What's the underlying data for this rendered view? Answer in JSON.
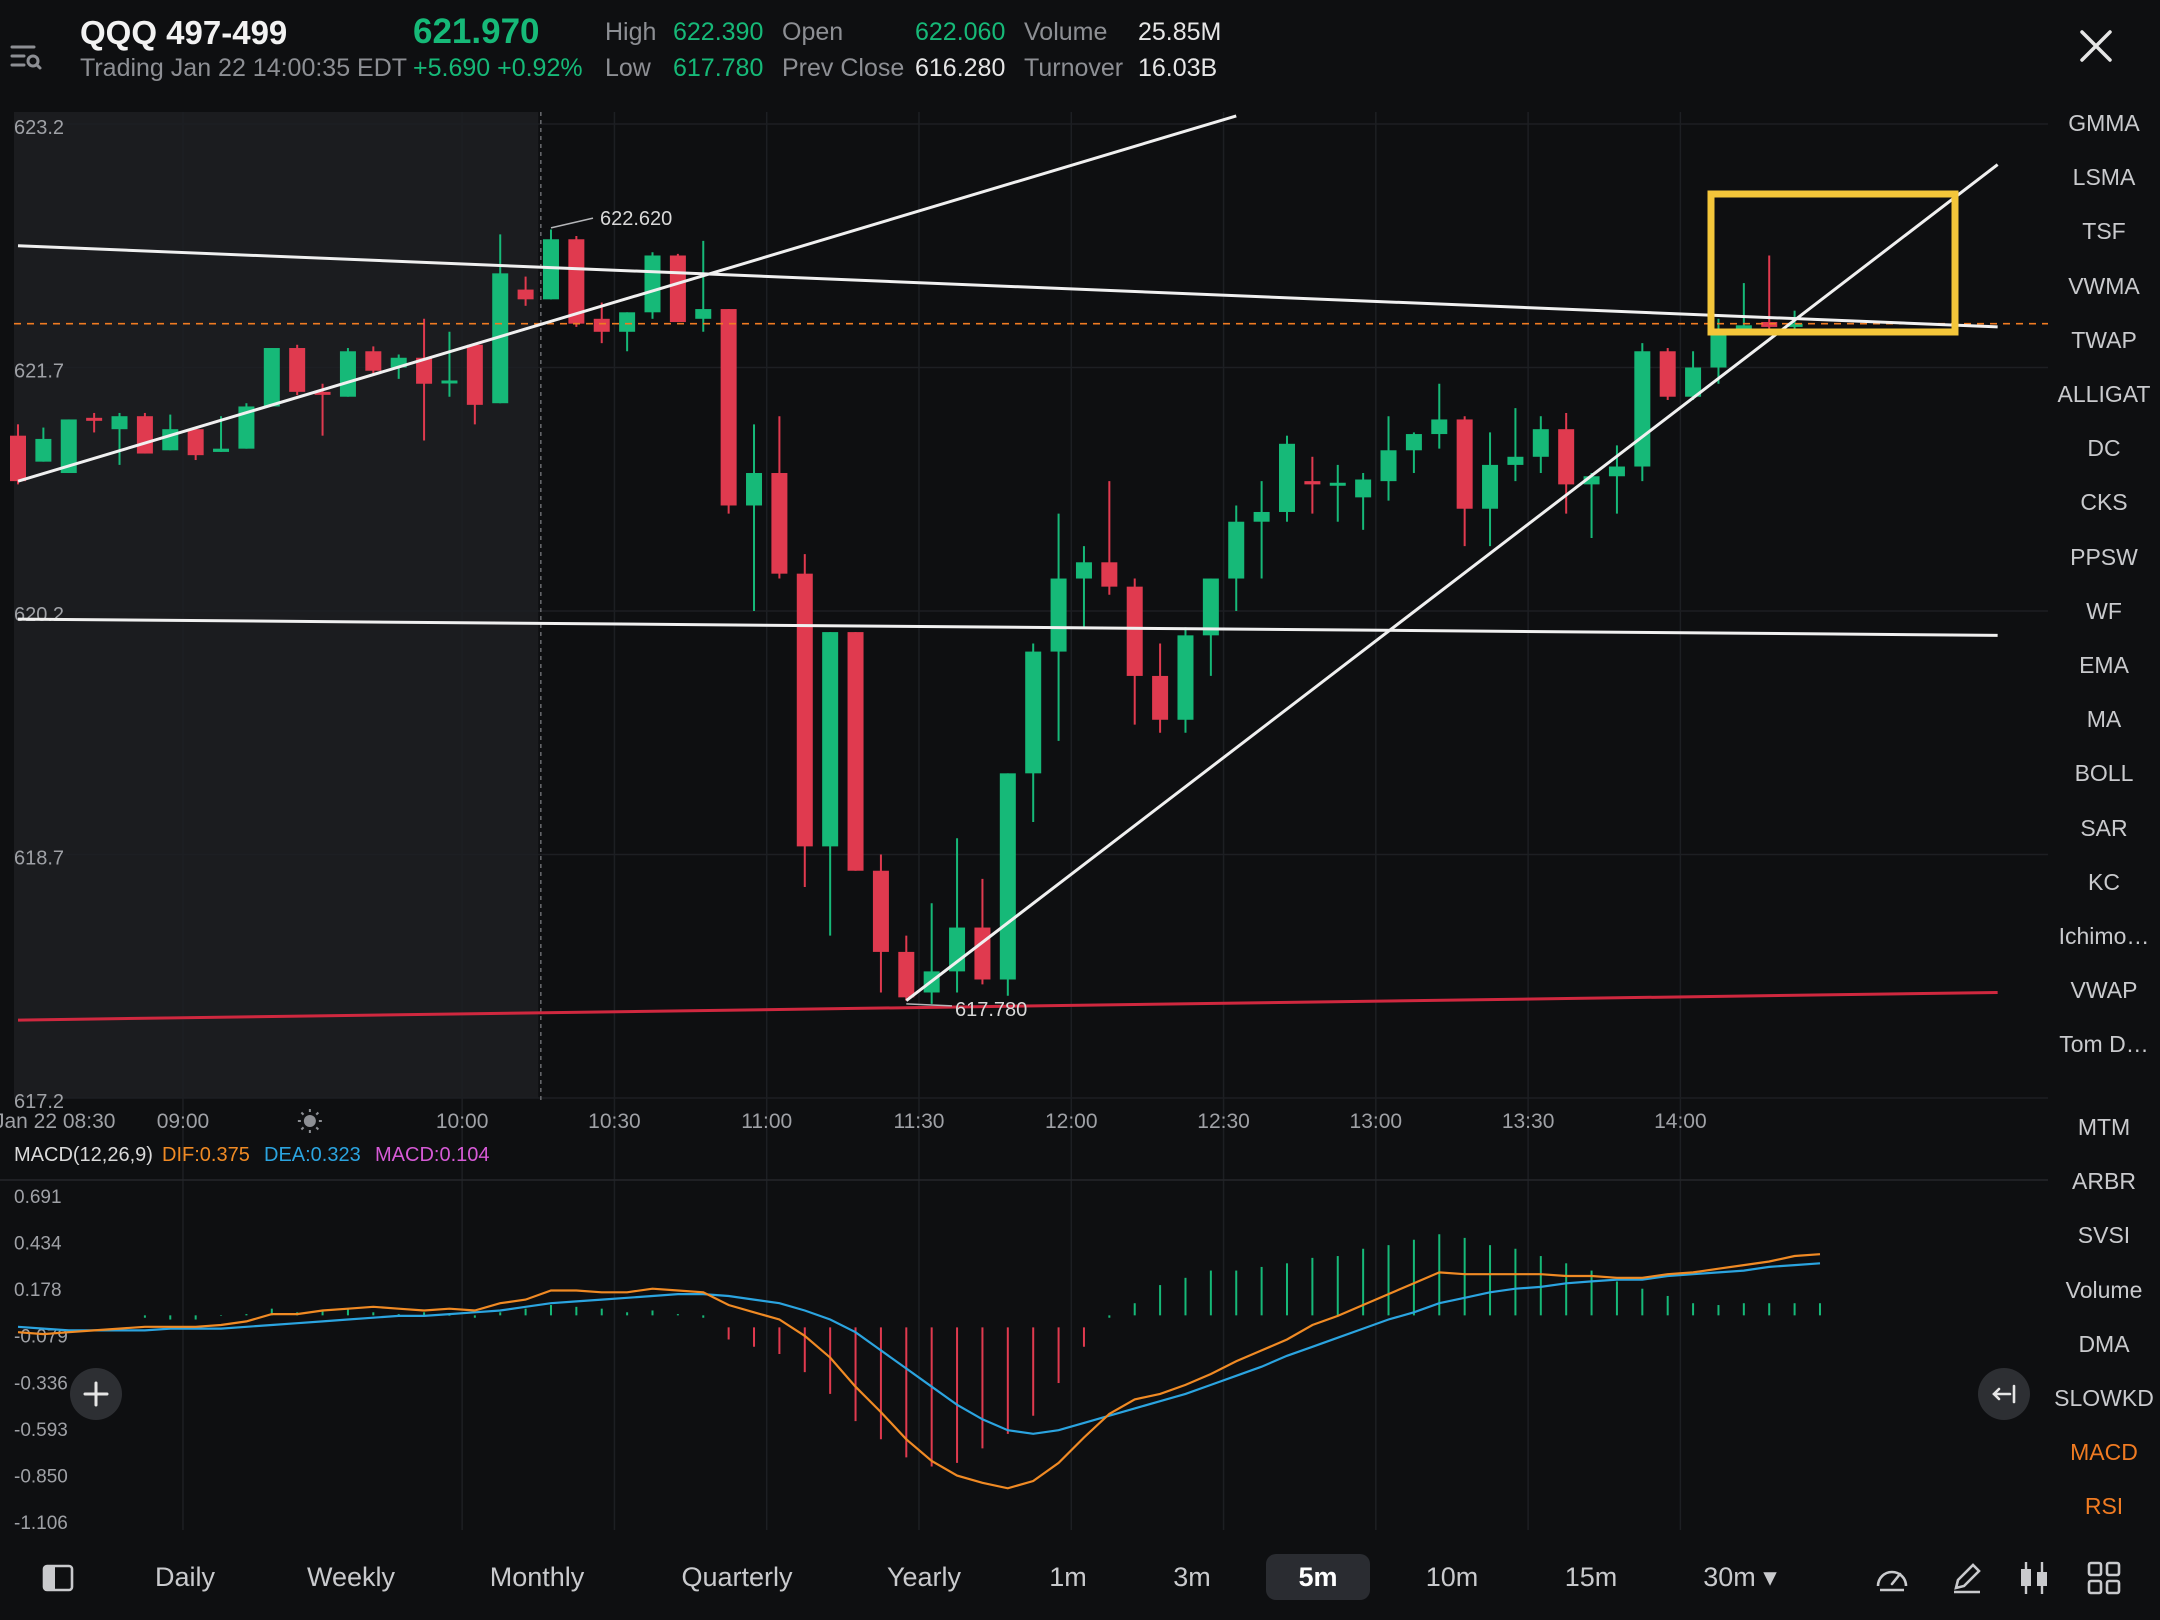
{
  "header": {
    "symbol": "QQQ  497-499",
    "status": "Trading Jan 22 14:00:35 EDT",
    "price": "621.970",
    "change": "+5.690 +0.92%",
    "high_label": "High",
    "high": "622.390",
    "low_label": "Low",
    "low": "617.780",
    "open_label": "Open",
    "open": "622.060",
    "prev_close_label": "Prev Close",
    "prev_close": "616.280",
    "volume_label": "Volume",
    "volume": "25.85M",
    "turnover_label": "Turnover",
    "turnover": "16.03B"
  },
  "colors": {
    "up": "#16b978",
    "down": "#e03a4f",
    "accent": "#f07b22",
    "highlight": "#f4c63a",
    "background": "#0e0f11"
  },
  "chart_data": {
    "type": "candlestick",
    "interval": "5m",
    "y_axis_labels": [
      "623.2",
      "621.7",
      "620.2",
      "618.7",
      "617.2"
    ],
    "ylim": [
      617.2,
      623.2
    ],
    "x_axis_labels": [
      "Jan 22 08:30",
      "09:00",
      "10:00",
      "10:30",
      "11:00",
      "11:30",
      "12:00",
      "12:30",
      "13:00",
      "13:30",
      "14:00"
    ],
    "annotations": {
      "high_marker": "622.620",
      "low_marker": "617.780"
    },
    "last_price_line": 621.97,
    "candles": [
      {
        "o": 621.28,
        "h": 621.35,
        "l": 620.98,
        "c": 621.0
      },
      {
        "o": 621.12,
        "h": 621.33,
        "l": 621.12,
        "c": 621.26
      },
      {
        "o": 621.05,
        "h": 621.38,
        "l": 621.05,
        "c": 621.38
      },
      {
        "o": 621.39,
        "h": 621.42,
        "l": 621.3,
        "c": 621.38
      },
      {
        "o": 621.32,
        "h": 621.42,
        "l": 621.1,
        "c": 621.4
      },
      {
        "o": 621.4,
        "h": 621.42,
        "l": 621.17,
        "c": 621.17
      },
      {
        "o": 621.19,
        "h": 621.41,
        "l": 621.19,
        "c": 621.32
      },
      {
        "o": 621.32,
        "h": 621.32,
        "l": 621.13,
        "c": 621.16
      },
      {
        "o": 621.18,
        "h": 621.4,
        "l": 621.18,
        "c": 621.2
      },
      {
        "o": 621.2,
        "h": 621.48,
        "l": 621.2,
        "c": 621.46
      },
      {
        "o": 621.46,
        "h": 621.82,
        "l": 621.46,
        "c": 621.82
      },
      {
        "o": 621.82,
        "h": 621.84,
        "l": 621.53,
        "c": 621.55
      },
      {
        "o": 621.55,
        "h": 621.6,
        "l": 621.28,
        "c": 621.54
      },
      {
        "o": 621.52,
        "h": 621.82,
        "l": 621.52,
        "c": 621.8
      },
      {
        "o": 621.8,
        "h": 621.83,
        "l": 621.65,
        "c": 621.68
      },
      {
        "o": 621.7,
        "h": 621.78,
        "l": 621.63,
        "c": 621.76
      },
      {
        "o": 621.76,
        "h": 622.0,
        "l": 621.25,
        "c": 621.6
      },
      {
        "o": 621.62,
        "h": 621.92,
        "l": 621.52,
        "c": 621.62
      },
      {
        "o": 621.84,
        "h": 621.84,
        "l": 621.35,
        "c": 621.47
      },
      {
        "o": 621.48,
        "h": 622.52,
        "l": 621.48,
        "c": 622.28
      },
      {
        "o": 622.18,
        "h": 622.26,
        "l": 622.08,
        "c": 622.12
      },
      {
        "o": 622.12,
        "h": 622.55,
        "l": 622.12,
        "c": 622.49
      },
      {
        "o": 622.49,
        "h": 622.51,
        "l": 621.95,
        "c": 621.97
      },
      {
        "o": 622.0,
        "h": 622.1,
        "l": 621.85,
        "c": 621.92
      },
      {
        "o": 621.92,
        "h": 622.04,
        "l": 621.8,
        "c": 622.04
      },
      {
        "o": 622.04,
        "h": 622.41,
        "l": 622.0,
        "c": 622.39
      },
      {
        "o": 622.39,
        "h": 622.4,
        "l": 621.98,
        "c": 621.98
      },
      {
        "o": 622.0,
        "h": 622.48,
        "l": 621.92,
        "c": 622.06
      },
      {
        "o": 622.06,
        "h": 622.06,
        "l": 620.8,
        "c": 620.85
      },
      {
        "o": 620.85,
        "h": 621.35,
        "l": 620.2,
        "c": 621.05
      },
      {
        "o": 621.05,
        "h": 621.4,
        "l": 620.4,
        "c": 620.43
      },
      {
        "o": 620.43,
        "h": 620.55,
        "l": 618.5,
        "c": 618.75
      },
      {
        "o": 618.75,
        "h": 620.07,
        "l": 618.2,
        "c": 620.07
      },
      {
        "o": 620.07,
        "h": 620.07,
        "l": 618.6,
        "c": 618.6
      },
      {
        "o": 618.6,
        "h": 618.7,
        "l": 617.85,
        "c": 618.1
      },
      {
        "o": 618.1,
        "h": 618.2,
        "l": 617.8,
        "c": 617.82
      },
      {
        "o": 617.85,
        "h": 618.4,
        "l": 617.78,
        "c": 617.98
      },
      {
        "o": 617.98,
        "h": 618.8,
        "l": 617.85,
        "c": 618.25
      },
      {
        "o": 618.25,
        "h": 618.55,
        "l": 617.9,
        "c": 617.93
      },
      {
        "o": 617.93,
        "h": 619.2,
        "l": 617.83,
        "c": 619.2
      },
      {
        "o": 619.2,
        "h": 620.0,
        "l": 618.9,
        "c": 619.95
      },
      {
        "o": 619.95,
        "h": 620.8,
        "l": 619.4,
        "c": 620.4
      },
      {
        "o": 620.4,
        "h": 620.6,
        "l": 620.1,
        "c": 620.5
      },
      {
        "o": 620.5,
        "h": 621.0,
        "l": 620.3,
        "c": 620.35
      },
      {
        "o": 620.35,
        "h": 620.4,
        "l": 619.5,
        "c": 619.8
      },
      {
        "o": 619.8,
        "h": 620.0,
        "l": 619.45,
        "c": 619.53
      },
      {
        "o": 619.53,
        "h": 620.1,
        "l": 619.45,
        "c": 620.05
      },
      {
        "o": 620.05,
        "h": 620.4,
        "l": 619.8,
        "c": 620.4
      },
      {
        "o": 620.4,
        "h": 620.85,
        "l": 620.2,
        "c": 620.75
      },
      {
        "o": 620.75,
        "h": 621.0,
        "l": 620.4,
        "c": 620.81
      },
      {
        "o": 620.81,
        "h": 621.28,
        "l": 620.75,
        "c": 621.23
      },
      {
        "o": 621.0,
        "h": 621.15,
        "l": 620.8,
        "c": 620.98
      },
      {
        "o": 620.98,
        "h": 621.1,
        "l": 620.75,
        "c": 620.99
      },
      {
        "o": 620.9,
        "h": 621.05,
        "l": 620.7,
        "c": 621.01
      },
      {
        "o": 621.0,
        "h": 621.4,
        "l": 620.88,
        "c": 621.19
      },
      {
        "o": 621.19,
        "h": 621.3,
        "l": 621.05,
        "c": 621.29
      },
      {
        "o": 621.29,
        "h": 621.6,
        "l": 621.2,
        "c": 621.38
      },
      {
        "o": 621.38,
        "h": 621.4,
        "l": 620.6,
        "c": 620.83
      },
      {
        "o": 620.83,
        "h": 621.3,
        "l": 620.6,
        "c": 621.1
      },
      {
        "o": 621.1,
        "h": 621.45,
        "l": 621.0,
        "c": 621.15
      },
      {
        "o": 621.15,
        "h": 621.4,
        "l": 621.05,
        "c": 621.32
      },
      {
        "o": 621.32,
        "h": 621.42,
        "l": 620.8,
        "c": 620.98
      },
      {
        "o": 620.98,
        "h": 621.05,
        "l": 620.65,
        "c": 621.03
      },
      {
        "o": 621.03,
        "h": 621.22,
        "l": 620.8,
        "c": 621.09
      },
      {
        "o": 621.09,
        "h": 621.85,
        "l": 621.0,
        "c": 621.8
      },
      {
        "o": 621.8,
        "h": 621.82,
        "l": 621.5,
        "c": 621.52
      },
      {
        "o": 621.52,
        "h": 621.8,
        "l": 621.5,
        "c": 621.7
      },
      {
        "o": 621.7,
        "h": 622.0,
        "l": 621.6,
        "c": 621.94
      },
      {
        "o": 621.94,
        "h": 622.22,
        "l": 621.9,
        "c": 621.96
      },
      {
        "o": 621.98,
        "h": 622.39,
        "l": 621.93,
        "c": 621.95
      },
      {
        "o": 621.95,
        "h": 622.05,
        "l": 621.9,
        "c": 621.97
      }
    ],
    "trend_lines": [
      {
        "color": "white",
        "from": {
          "candle": 0,
          "price": 622.45
        },
        "to": {
          "candle": 78,
          "price": 621.95
        }
      },
      {
        "color": "white",
        "from": {
          "candle": 0,
          "price": 621.0
        },
        "to": {
          "candle": 48,
          "price": 623.25
        }
      },
      {
        "color": "white",
        "from": {
          "candle": 0,
          "price": 620.15
        },
        "to": {
          "candle": 78,
          "price": 620.05
        }
      },
      {
        "color": "white",
        "from": {
          "candle": 35,
          "price": 617.8
        },
        "to": {
          "candle": 78,
          "price": 622.95
        }
      },
      {
        "color": "red",
        "from": {
          "candle": 0,
          "price": 617.68
        },
        "to": {
          "candle": 78,
          "price": 617.85
        }
      }
    ],
    "macd": {
      "title": "MACD(12,26,9)",
      "dif_label": "DIF:0.375",
      "dea_label": "DEA:0.323",
      "macd_label": "MACD:0.104",
      "y_axis_labels": [
        "0.691",
        "0.434",
        "0.178",
        "-0.079",
        "-0.336",
        "-0.593",
        "-0.850",
        "-1.106"
      ],
      "ylim": [
        -1.106,
        0.691
      ],
      "dif": [
        -0.06,
        -0.07,
        -0.06,
        -0.05,
        -0.04,
        -0.03,
        -0.03,
        -0.03,
        -0.02,
        0.0,
        0.04,
        0.04,
        0.06,
        0.07,
        0.08,
        0.07,
        0.06,
        0.07,
        0.06,
        0.1,
        0.12,
        0.17,
        0.17,
        0.16,
        0.16,
        0.18,
        0.17,
        0.16,
        0.09,
        0.05,
        0.01,
        -0.08,
        -0.2,
        -0.36,
        -0.5,
        -0.65,
        -0.77,
        -0.85,
        -0.89,
        -0.92,
        -0.88,
        -0.78,
        -0.64,
        -0.51,
        -0.43,
        -0.4,
        -0.35,
        -0.29,
        -0.22,
        -0.16,
        -0.1,
        -0.02,
        0.03,
        0.09,
        0.15,
        0.21,
        0.27,
        0.26,
        0.26,
        0.26,
        0.26,
        0.25,
        0.25,
        0.24,
        0.24,
        0.26,
        0.27,
        0.29,
        0.31,
        0.33,
        0.36,
        0.37
      ],
      "dea": [
        -0.03,
        -0.04,
        -0.05,
        -0.05,
        -0.05,
        -0.05,
        -0.04,
        -0.04,
        -0.04,
        -0.03,
        -0.02,
        -0.01,
        0.0,
        0.01,
        0.02,
        0.03,
        0.03,
        0.04,
        0.05,
        0.06,
        0.08,
        0.1,
        0.11,
        0.12,
        0.13,
        0.14,
        0.15,
        0.15,
        0.14,
        0.12,
        0.1,
        0.06,
        0.01,
        -0.06,
        -0.16,
        -0.26,
        -0.36,
        -0.46,
        -0.54,
        -0.6,
        -0.62,
        -0.6,
        -0.56,
        -0.52,
        -0.48,
        -0.44,
        -0.4,
        -0.35,
        -0.3,
        -0.25,
        -0.19,
        -0.14,
        -0.09,
        -0.04,
        0.01,
        0.05,
        0.1,
        0.13,
        0.16,
        0.18,
        0.19,
        0.21,
        0.22,
        0.23,
        0.23,
        0.25,
        0.26,
        0.27,
        0.28,
        0.3,
        0.31,
        0.32
      ],
      "hist": [
        0.0,
        0.0,
        0.0,
        0.0,
        0.0,
        0.02,
        0.01,
        0.01,
        0.03,
        0.04,
        0.07,
        0.05,
        0.06,
        0.07,
        0.05,
        0.04,
        0.05,
        0.03,
        0.02,
        0.05,
        0.07,
        0.09,
        0.08,
        0.07,
        0.05,
        0.06,
        0.04,
        0.02,
        -0.1,
        -0.14,
        -0.18,
        -0.28,
        -0.4,
        -0.55,
        -0.65,
        -0.75,
        -0.8,
        -0.78,
        -0.7,
        -0.62,
        -0.52,
        -0.34,
        -0.14,
        0.02,
        0.1,
        0.2,
        0.24,
        0.28,
        0.28,
        0.3,
        0.32,
        0.35,
        0.36,
        0.4,
        0.42,
        0.45,
        0.48,
        0.46,
        0.42,
        0.4,
        0.36,
        0.32,
        0.28,
        0.22,
        0.18,
        0.14,
        0.1,
        0.09,
        0.1,
        0.1,
        0.1,
        0.1
      ]
    }
  },
  "indicators_main": [
    "GMMA",
    "LSMA",
    "TSF",
    "VWMA",
    "TWAP",
    "ALLIGAT",
    "DC",
    "CKS",
    "PPSW",
    "WF",
    "EMA",
    "MA",
    "BOLL",
    "SAR",
    "KC",
    "Ichimo…",
    "VWAP",
    "Tom D…"
  ],
  "indicators_sub": [
    "MTM",
    "ARBR",
    "SVSI",
    "Volume",
    "DMA",
    "SLOWKD",
    "MACD",
    "RSI"
  ],
  "timeframes": [
    "Daily",
    "Weekly",
    "Monthly",
    "Quarterly",
    "Yearly",
    "1m",
    "3m",
    "5m",
    "10m",
    "15m",
    "30m ▾"
  ],
  "active_timeframe": "5m",
  "icons": {
    "menu": "menu-list-icon",
    "close": "close-icon",
    "add": "plus-icon",
    "collapse": "collapse-arrow-icon",
    "sidebar": "sidebar-toggle-icon",
    "speed": "gauge-icon",
    "draw": "pencil-icon",
    "candles": "candlestick-icon",
    "grid": "grid-icon"
  }
}
